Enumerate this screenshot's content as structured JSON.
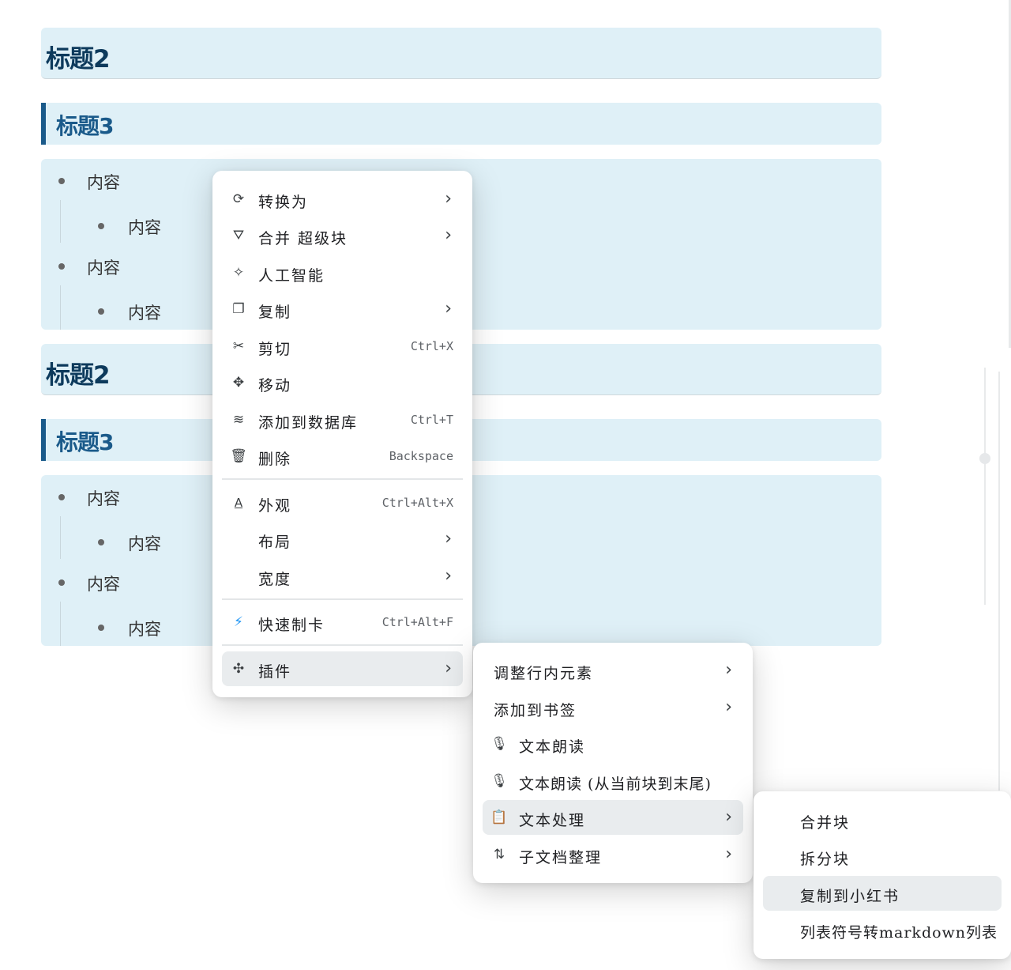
{
  "editor": {
    "blocks": [
      {
        "kind": "h2",
        "text": "标题2"
      },
      {
        "kind": "h3",
        "text": "标题3"
      },
      {
        "kind": "list",
        "items": [
          "内容",
          "内容",
          "内容",
          "内容"
        ]
      },
      {
        "kind": "h2",
        "text": "标题2"
      },
      {
        "kind": "h3",
        "text": "标题3"
      },
      {
        "kind": "list",
        "items": [
          "内容",
          "内容",
          "内容",
          "内容"
        ]
      }
    ]
  },
  "context_menu": {
    "items": [
      {
        "icon": "convert-icon",
        "label": "转换为",
        "submenu": true
      },
      {
        "icon": "merge-superblock-icon",
        "label": "合并 超级块",
        "submenu": true
      },
      {
        "icon": "ai-sparkle-icon",
        "label": "人工智能"
      },
      {
        "icon": "copy-icon",
        "label": "复制",
        "submenu": true
      },
      {
        "icon": "scissors-icon",
        "label": "剪切",
        "shortcut": "Ctrl+X"
      },
      {
        "icon": "move-icon",
        "label": "移动"
      },
      {
        "icon": "database-icon",
        "label": "添加到数据库",
        "shortcut": "Ctrl+T"
      },
      {
        "icon": "trash-icon",
        "label": "删除",
        "shortcut": "Backspace"
      },
      {
        "icon": "appearance-icon",
        "label": "外观",
        "shortcut": "Ctrl+Alt+X"
      },
      {
        "icon": "",
        "label": "布局",
        "submenu": true
      },
      {
        "icon": "",
        "label": "宽度",
        "submenu": true
      },
      {
        "icon": "lightning-icon",
        "label": "快速制卡",
        "shortcut": "Ctrl+Alt+F"
      },
      {
        "icon": "plugin-icon",
        "label": "插件",
        "submenu": true,
        "active": true
      }
    ]
  },
  "plugin_menu": {
    "items": [
      {
        "icon": "",
        "label": "调整行内元素",
        "submenu": true
      },
      {
        "icon": "",
        "label": "添加到书签",
        "submenu": true
      },
      {
        "icon": "microphone-icon",
        "label": "文本朗读"
      },
      {
        "icon": "microphone-icon",
        "label": "文本朗读 (从当前块到末尾)"
      },
      {
        "icon": "clipboard-icon",
        "label": "文本处理",
        "submenu": true,
        "active": true
      },
      {
        "icon": "sort-icon",
        "label": "子文档整理",
        "submenu": true
      }
    ]
  },
  "text_menu": {
    "items": [
      {
        "label": "合并块"
      },
      {
        "label": "拆分块"
      },
      {
        "label": "复制到小红书",
        "active": true
      },
      {
        "label": "列表符号转markdown列表"
      }
    ]
  },
  "icon_glyphs": {
    "convert-icon": "⟳",
    "merge-superblock-icon": "⛛",
    "ai-sparkle-icon": "✧",
    "copy-icon": "❐",
    "scissors-icon": "✂",
    "move-icon": "✥",
    "database-icon": "≋",
    "trash-icon": "🗑",
    "appearance-icon": "A",
    "lightning-icon": "⚡",
    "plugin-icon": "✣",
    "microphone-icon": "🎙",
    "clipboard-icon": "📋",
    "sort-icon": "⇅",
    "chevron-right-icon": "›"
  },
  "colors": {
    "block_bg": "#dff0f7",
    "h2_text": "#0d3a5c",
    "h3_text": "#1a5a8a",
    "h3_border": "#1a5a8a",
    "active_item_bg": "#e9ecee",
    "lightning": "#2196f3"
  }
}
